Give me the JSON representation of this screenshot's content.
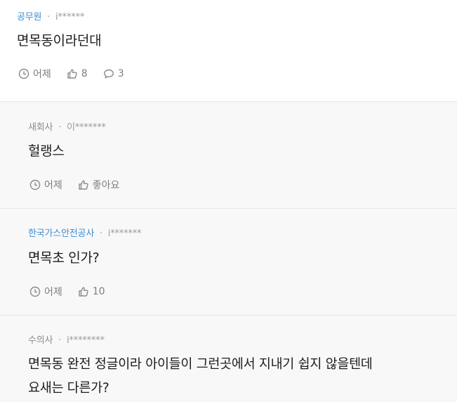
{
  "post": {
    "company": "공무원",
    "user": "i******",
    "text": "면목동이라던대",
    "time": "어제",
    "likes": "8",
    "comments": "3"
  },
  "replies": [
    {
      "company": "새회사",
      "company_color": "#8b8b90",
      "user": "이*******",
      "text": "헐랭스",
      "time": "어제",
      "like_label": "좋아요"
    },
    {
      "company": "한국가스안전공사",
      "company_color": "#3b8fd3",
      "user": "i*******",
      "text": "면목초 인가?",
      "time": "어제",
      "like_label": "10"
    },
    {
      "company": "수의사",
      "company_color": "#8b8b90",
      "user": "i********",
      "text_line1": "면목동 완전 정글이라 아이들이 그런곳에서 지내기 쉽지 않을텐데",
      "text_line2": "요새는 다른가?"
    }
  ],
  "separator": "·",
  "icons": {
    "time": "clock-icon",
    "like": "thumbs-up-icon",
    "comment": "speech-bubble-icon"
  }
}
